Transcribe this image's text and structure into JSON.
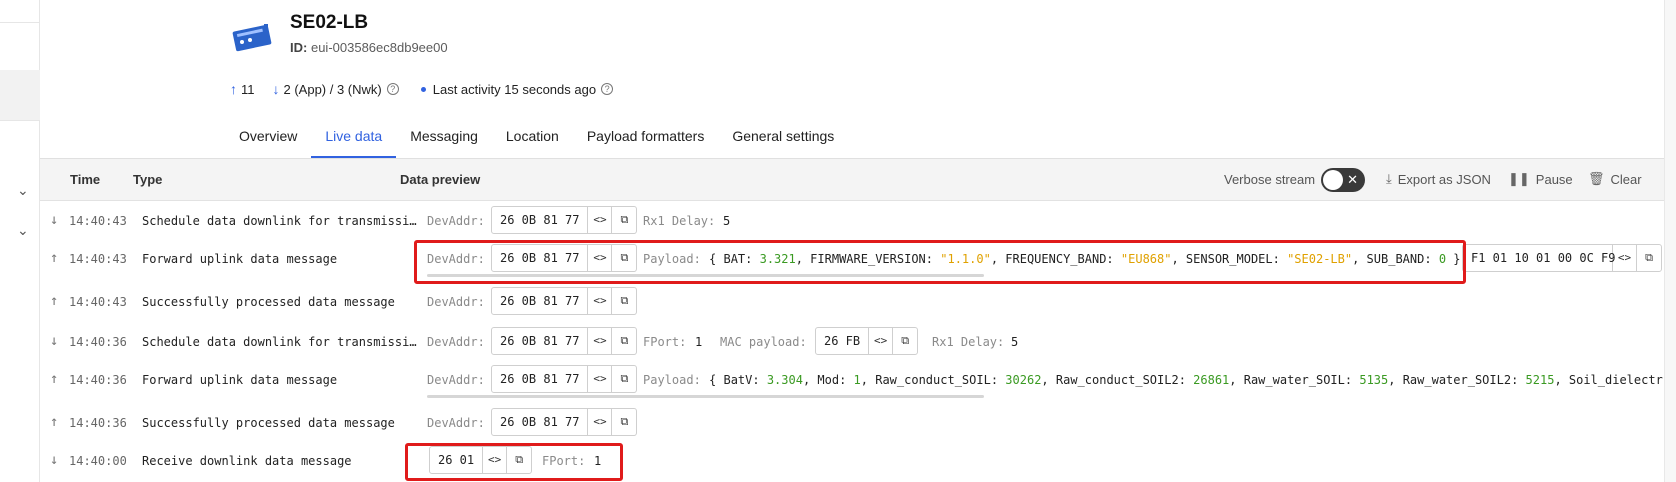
{
  "device": {
    "name": "SE02-LB",
    "id_label": "ID:",
    "id_value": "eui-003586ec8db9ee00"
  },
  "stats": {
    "uplink_count": "11",
    "downlink_count": "2 (App) / 3 (Nwk)",
    "activity": "Last activity 15 seconds ago"
  },
  "tabs": [
    {
      "label": "Overview",
      "active": false
    },
    {
      "label": "Live data",
      "active": true
    },
    {
      "label": "Messaging",
      "active": false
    },
    {
      "label": "Location",
      "active": false
    },
    {
      "label": "Payload formatters",
      "active": false
    },
    {
      "label": "General settings",
      "active": false
    }
  ],
  "live": {
    "col_time": "Time",
    "col_type": "Type",
    "col_preview": "Data preview",
    "verbose_label": "Verbose stream",
    "export_label": "Export as JSON",
    "pause_label": "Pause",
    "clear_label": "Clear"
  },
  "rows": [
    {
      "dir": "down",
      "time": "14:40:43",
      "type": "Schedule data downlink for transmission",
      "devaddr_label": "DevAddr:",
      "devaddr": "26 0B 81 77",
      "extra_label": "Rx1 Delay:",
      "extra_value": "5"
    },
    {
      "dir": "up",
      "time": "14:40:43",
      "type": "Forward uplink data message",
      "devaddr_label": "DevAddr:",
      "devaddr": "26 0B 81 77",
      "payload_label": "Payload:",
      "payload": {
        "open": "{",
        "k1": "BAT:",
        "v1": "3.321",
        "k2": ", FIRMWARE_VERSION:",
        "v2": "\"1.1.0\"",
        "k3": ", FREQUENCY_BAND:",
        "v3": "\"EU868\"",
        "k4": ", SENSOR_MODEL:",
        "v4": "\"SE02-LB\"",
        "k5": ", SUB_BAND:",
        "v5": "0",
        "close": "}"
      },
      "raw": "F1 01 10 01 00 0C F9"
    },
    {
      "dir": "up",
      "time": "14:40:43",
      "type": "Successfully processed data message",
      "devaddr_label": "DevAddr:",
      "devaddr": "26 0B 81 77"
    },
    {
      "dir": "down",
      "time": "14:40:36",
      "type": "Schedule data downlink for transmission",
      "devaddr_label": "DevAddr:",
      "devaddr": "26 0B 81 77",
      "fport_label": "FPort:",
      "fport": "1",
      "mac_label": "MAC payload:",
      "mac": "26 FB",
      "extra_label": "Rx1 Delay:",
      "extra_value": "5"
    },
    {
      "dir": "up",
      "time": "14:40:36",
      "type": "Forward uplink data message",
      "devaddr_label": "DevAddr:",
      "devaddr": "26 0B 81 77",
      "payload_label": "Payload:",
      "payload": {
        "open": "{",
        "k1": "BatV:",
        "v1": "3.304",
        "k2": ", Mod:",
        "v2": "1",
        "k3": ", Raw_conduct_SOIL:",
        "v3": "30262",
        "k4": ", Raw_conduct_SOIL2:",
        "v4": "26861",
        "k5": ", Raw_water_SOIL:",
        "v5": "5135",
        "k6": ", Raw_water_SOIL2:",
        "v6": "5215",
        "k7": ", Soil_dielectr"
      }
    },
    {
      "dir": "up",
      "time": "14:40:36",
      "type": "Successfully processed data message",
      "devaddr_label": "DevAddr:",
      "devaddr": "26 0B 81 77"
    },
    {
      "dir": "down",
      "time": "14:40:00",
      "type": "Receive downlink data message",
      "data": "26 01",
      "fport_label": "FPort:",
      "fport": "1"
    }
  ],
  "colors": {
    "accent": "#3162e0",
    "highlight": "#e01b1b",
    "number": "#3a9a22",
    "string": "#e0a100"
  }
}
